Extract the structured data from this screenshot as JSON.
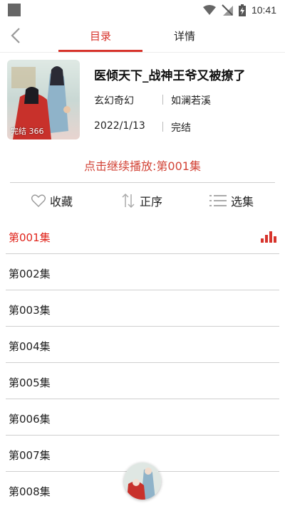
{
  "status_bar": {
    "time": "10:41"
  },
  "nav": {
    "tabs": [
      {
        "label": "目录"
      },
      {
        "label": "详情"
      }
    ]
  },
  "book": {
    "title": "医倾天下_战神王爷又被撩了",
    "genre": "玄幻奇幻",
    "author": "如澜若溪",
    "date": "2022/1/13",
    "status": "完结",
    "cover_label": "完结 366"
  },
  "continue_play": "点击继续播放:第001集",
  "actions": {
    "favorite": "收藏",
    "order": "正序",
    "select": "选集"
  },
  "episodes": [
    {
      "label": "第001集"
    },
    {
      "label": "第002集"
    },
    {
      "label": "第003集"
    },
    {
      "label": "第004集"
    },
    {
      "label": "第005集"
    },
    {
      "label": "第006集"
    },
    {
      "label": "第007集"
    },
    {
      "label": "第008集"
    }
  ],
  "colors": {
    "accent": "#d7342c"
  }
}
